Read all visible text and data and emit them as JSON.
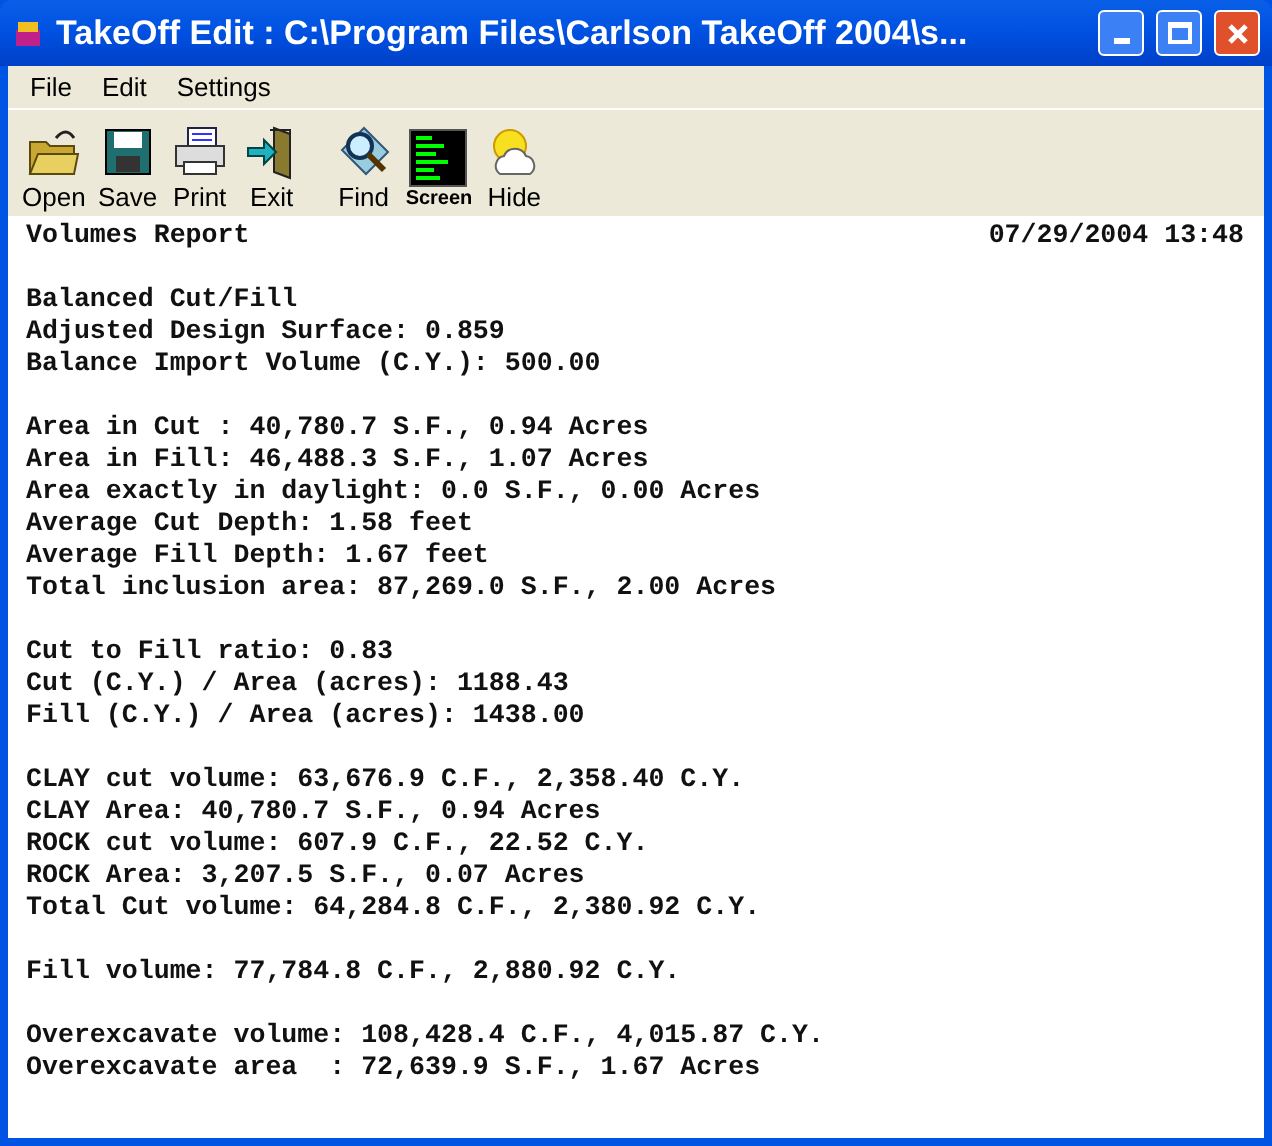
{
  "window": {
    "title": "TakeOff Edit : C:\\Program Files\\Carlson TakeOff 2004\\s..."
  },
  "menu": [
    "File",
    "Edit",
    "Settings"
  ],
  "toolbar": [
    {
      "label": "Open",
      "kind": "open"
    },
    {
      "label": "Save",
      "kind": "save"
    },
    {
      "label": "Print",
      "kind": "print"
    },
    {
      "label": "Exit",
      "kind": "exit"
    },
    {
      "label": "Find",
      "kind": "find"
    },
    {
      "label": "Screen",
      "kind": "screen"
    },
    {
      "label": "Hide",
      "kind": "hide"
    }
  ],
  "report": {
    "title": "Volumes Report",
    "date": "07/29/2004 13:48",
    "sections": [
      [
        "Balanced Cut/Fill",
        "Adjusted Design Surface: 0.859",
        "Balance Import Volume (C.Y.): 500.00"
      ],
      [
        "Area in Cut : 40,780.7 S.F., 0.94 Acres",
        "Area in Fill: 46,488.3 S.F., 1.07 Acres",
        "Area exactly in daylight: 0.0 S.F., 0.00 Acres",
        "Average Cut Depth: 1.58 feet",
        "Average Fill Depth: 1.67 feet",
        "Total inclusion area: 87,269.0 S.F., 2.00 Acres"
      ],
      [
        "Cut to Fill ratio: 0.83",
        "Cut (C.Y.) / Area (acres): 1188.43",
        "Fill (C.Y.) / Area (acres): 1438.00"
      ],
      [
        "CLAY cut volume: 63,676.9 C.F., 2,358.40 C.Y.",
        "CLAY Area: 40,780.7 S.F., 0.94 Acres",
        "ROCK cut volume: 607.9 C.F., 22.52 C.Y.",
        "ROCK Area: 3,207.5 S.F., 0.07 Acres",
        "Total Cut volume: 64,284.8 C.F., 2,380.92 C.Y."
      ],
      [
        "Fill volume: 77,784.8 C.F., 2,880.92 C.Y."
      ],
      [
        "Overexcavate volume: 108,428.4 C.F., 4,015.87 C.Y.",
        "Overexcavate area  : 72,639.9 S.F., 1.67 Acres"
      ]
    ]
  }
}
